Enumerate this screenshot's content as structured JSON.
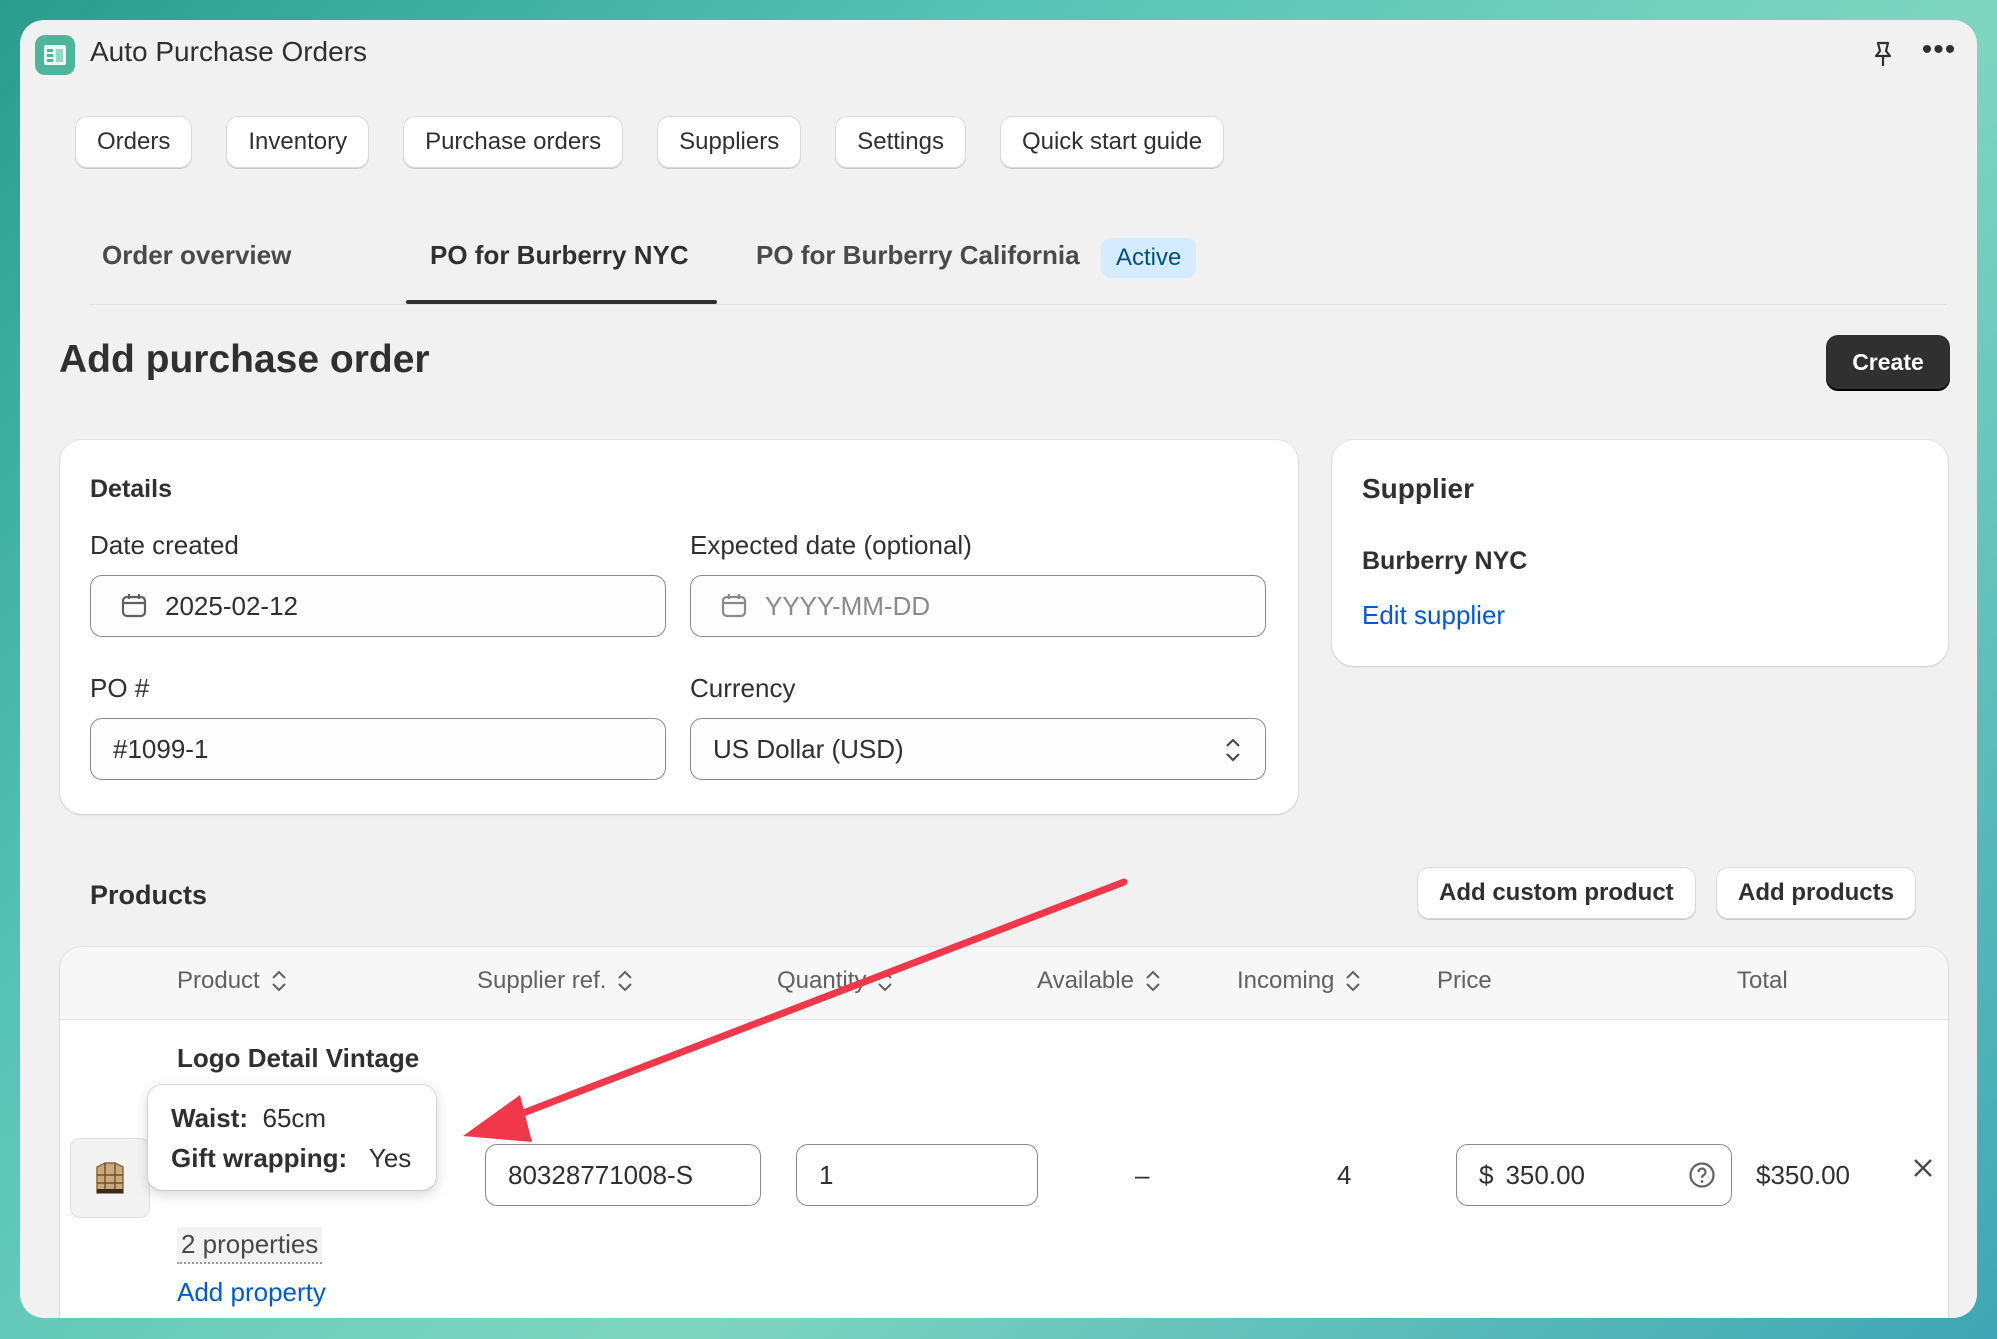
{
  "app": {
    "title": "Auto Purchase Orders"
  },
  "nav": [
    {
      "label": "Orders"
    },
    {
      "label": "Inventory"
    },
    {
      "label": "Purchase orders"
    },
    {
      "label": "Suppliers"
    },
    {
      "label": "Settings"
    },
    {
      "label": "Quick start guide"
    }
  ],
  "tabs": {
    "overview": "Order overview",
    "nyc": "PO for Burberry NYC",
    "california": "PO for Burberry California",
    "california_badge": "Active",
    "selected": "PO for Burberry NYC"
  },
  "page": {
    "title": "Add purchase order",
    "create_label": "Create"
  },
  "details": {
    "heading": "Details",
    "date_created_label": "Date created",
    "date_created_value": "2025-02-12",
    "expected_date_label": "Expected date (optional)",
    "expected_date_placeholder": "YYYY-MM-DD",
    "po_label": "PO #",
    "po_value": "#1099-1",
    "currency_label": "Currency",
    "currency_value": "US Dollar (USD)"
  },
  "supplier": {
    "heading": "Supplier",
    "name": "Burberry NYC",
    "edit_label": "Edit supplier"
  },
  "products": {
    "heading": "Products",
    "add_custom_label": "Add custom product",
    "add_products_label": "Add products",
    "columns": [
      "Product",
      "Supplier ref.",
      "Quantity",
      "Available",
      "Incoming",
      "Price",
      "Total"
    ],
    "rows": [
      {
        "name": "Logo Detail Vintage Check Bra Top",
        "properties_label": "2 properties",
        "add_property_label": "Add property",
        "supplier_ref": "80328771008-S",
        "quantity": "1",
        "available": "–",
        "incoming": "4",
        "price_currency": "$",
        "price": "350.00",
        "total": "$350.00"
      }
    ]
  },
  "tooltip": {
    "waist_label": "Waist:",
    "waist_value": "65cm",
    "gift_label": "Gift wrapping:",
    "gift_value": "Yes"
  },
  "annotation": {
    "arrow_color": "#f0384a"
  }
}
